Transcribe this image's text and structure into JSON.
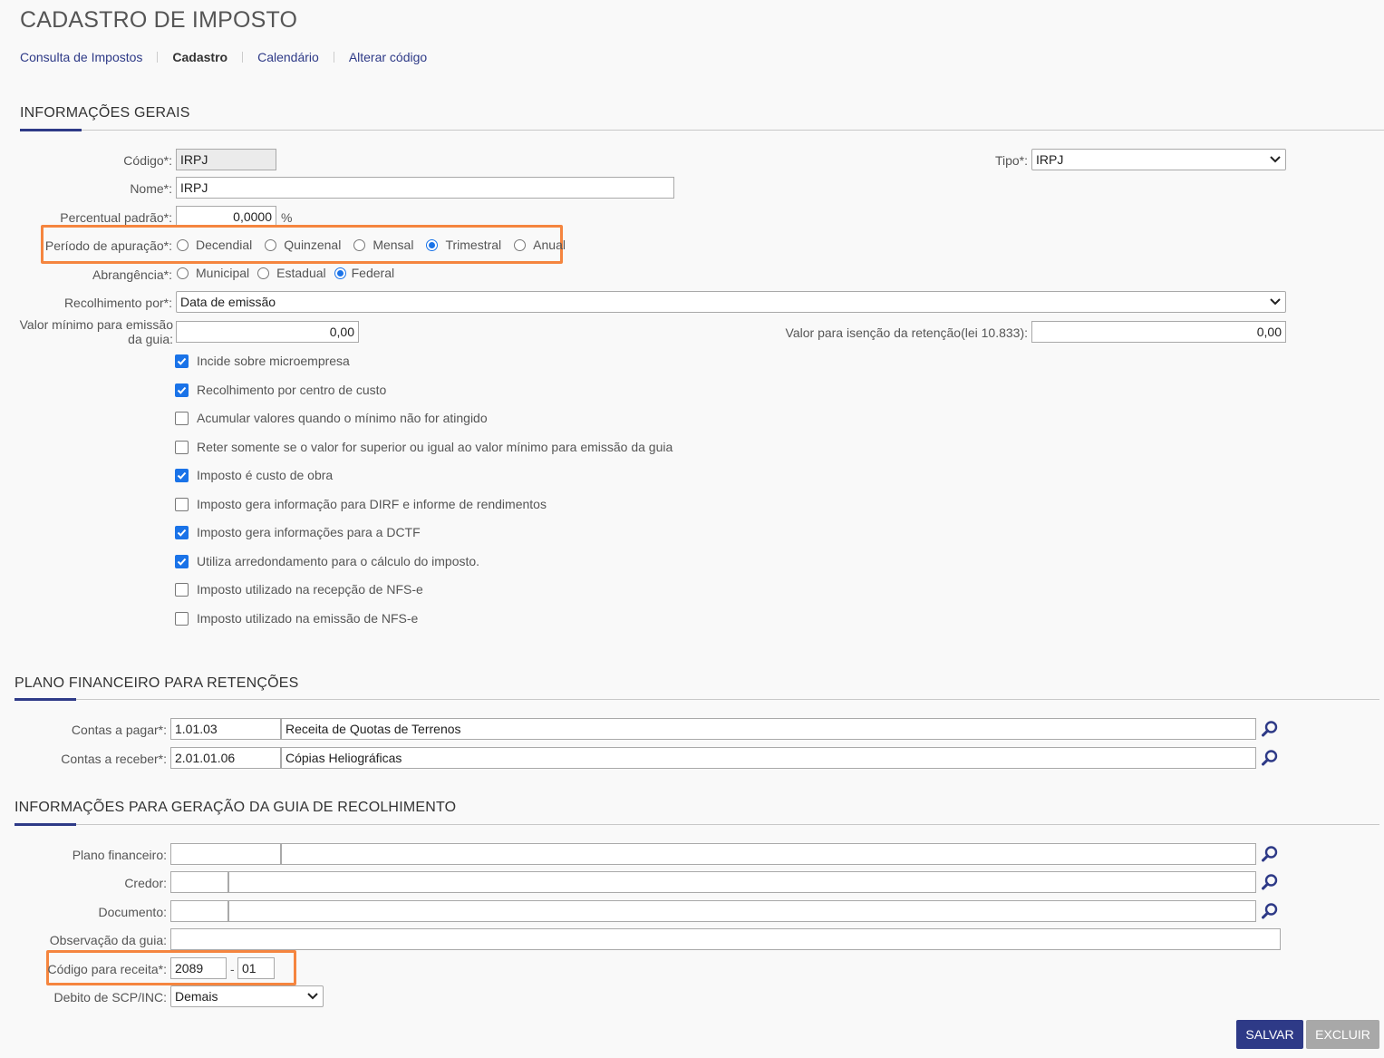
{
  "header": {
    "title": "CADASTRO DE IMPOSTO",
    "nav": [
      "Consulta de Impostos",
      "Cadastro",
      "Calendário",
      "Alterar código"
    ]
  },
  "general": {
    "section_title": "INFORMAÇÕES GERAIS",
    "codigo_label": "Código*:",
    "codigo_value": "IRPJ",
    "tipo_label": "Tipo*:",
    "tipo_value": "IRPJ",
    "nome_label": "Nome*:",
    "nome_value": "IRPJ",
    "percentual_label": "Percentual padrão*:",
    "percentual_value": "0,0000",
    "percentual_unit": "%",
    "periodo_label": "Período de apuração*:",
    "periodo_options": [
      "Decendial",
      "Quinzenal",
      "Mensal",
      "Trimestral",
      "Anual"
    ],
    "periodo_selected": "Trimestral",
    "abrangencia_label": "Abrangência*:",
    "abrangencia_options": [
      "Municipal",
      "Estadual",
      "Federal"
    ],
    "abrangencia_selected": "Federal",
    "recolhimento_label": "Recolhimento por*:",
    "recolhimento_value": "Data de emissão",
    "valor_minimo_label_1": "Valor mínimo para emissão",
    "valor_minimo_label_2": "da guia:",
    "valor_minimo_value": "0,00",
    "valor_isencao_label": "Valor para isenção da retenção(lei 10.833):",
    "valor_isencao_value": "0,00",
    "checkboxes": [
      {
        "label": "Incide sobre microempresa",
        "checked": true
      },
      {
        "label": "Recolhimento por centro de custo",
        "checked": true
      },
      {
        "label": "Acumular valores quando o mínimo não for atingido",
        "checked": false
      },
      {
        "label": "Reter somente se o valor for superior ou igual ao valor mínimo para emissão da guia",
        "checked": false
      },
      {
        "label": "Imposto é custo de obra",
        "checked": true
      },
      {
        "label": "Imposto gera informação para DIRF e informe de rendimentos",
        "checked": false
      },
      {
        "label": "Imposto gera informações para a DCTF",
        "checked": true
      },
      {
        "label": "Utiliza arredondamento para o cálculo do imposto.",
        "checked": true
      },
      {
        "label": "Imposto utilizado na recepção de NFS-e",
        "checked": false
      },
      {
        "label": "Imposto utilizado na emissão de NFS-e",
        "checked": false
      }
    ]
  },
  "financial": {
    "section_title": "PLANO FINANCEIRO PARA RETENÇÕES",
    "pagar_label": "Contas a pagar*:",
    "pagar_code": "1.01.03",
    "pagar_desc": "Receita de Quotas de Terrenos",
    "receber_label": "Contas a receber*:",
    "receber_code": "2.01.01.06",
    "receber_desc": "Cópias Heliográficas"
  },
  "guide": {
    "section_title": "INFORMAÇÕES PARA GERAÇÃO DA GUIA DE RECOLHIMENTO",
    "plano_label": "Plano financeiro:",
    "credor_label": "Credor:",
    "documento_label": "Documento:",
    "observacao_label": "Observação da guia:",
    "codigo_receita_label": "Código para receita*:",
    "codigo_receita_1": "2089",
    "codigo_receita_sep": "-",
    "codigo_receita_2": "01",
    "debito_label": "Debito de SCP/INC:",
    "debito_value": "Demais"
  },
  "actions": {
    "save_label": "SALVAR",
    "delete_label": "EXCLUIR"
  },
  "colors": {
    "accent": "#2e3a87",
    "highlight": "#f5853f",
    "check": "#1a73e8",
    "disabled": "#a8a8a8"
  }
}
